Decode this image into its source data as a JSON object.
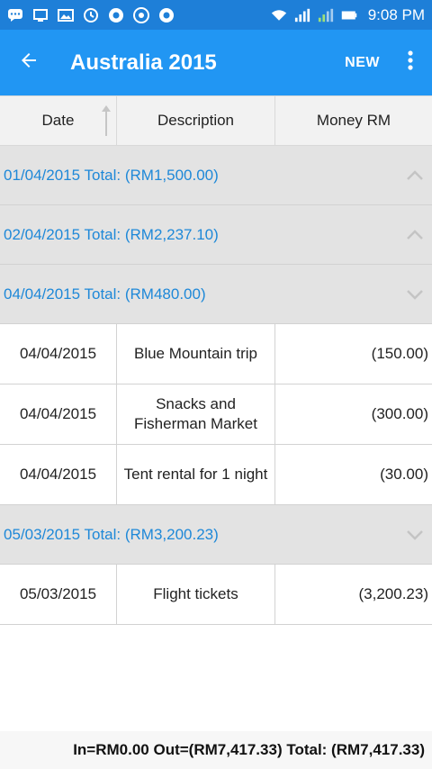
{
  "status_bar": {
    "time": "9:08 PM",
    "left_icons": [
      "chat-icon",
      "cast-icon",
      "image-icon",
      "sync-icon",
      "chrome-icon",
      "chrome-icon",
      "chrome-icon"
    ],
    "right_icons": [
      "wifi-icon",
      "signal-icon",
      "signal-icon",
      "battery-icon"
    ]
  },
  "app_bar": {
    "title": "Australia 2015",
    "new_label": "NEW",
    "back_icon": "back-arrow-icon",
    "more_icon": "more-vert-icon"
  },
  "table_header": {
    "date": "Date",
    "description": "Description",
    "money": "Money RM"
  },
  "groups": [
    {
      "label": "01/04/2015 Total: (RM1,500.00)",
      "expanded": false,
      "items": []
    },
    {
      "label": "02/04/2015 Total: (RM2,237.10)",
      "expanded": false,
      "items": []
    },
    {
      "label": "04/04/2015 Total: (RM480.00)",
      "expanded": true,
      "items": [
        {
          "date": "04/04/2015",
          "description": "Blue Mountain trip",
          "money": "(150.00)"
        },
        {
          "date": "04/04/2015",
          "description": "Snacks and Fisherman Market",
          "money": "(300.00)"
        },
        {
          "date": "04/04/2015",
          "description": "Tent rental for 1 night",
          "money": "(30.00)"
        }
      ]
    },
    {
      "label": "05/03/2015 Total: (RM3,200.23)",
      "expanded": true,
      "items": [
        {
          "date": "05/03/2015",
          "description": "Flight tickets",
          "money": "(3,200.23)"
        }
      ]
    }
  ],
  "footer": {
    "summary": "In=RM0.00 Out=(RM7,417.33) Total: (RM7,417.33)"
  },
  "colors": {
    "status_bar": "#1E7FD8",
    "app_bar": "#2196F3",
    "group_text": "#1E88D8",
    "group_bg": "#E3E3E3"
  }
}
